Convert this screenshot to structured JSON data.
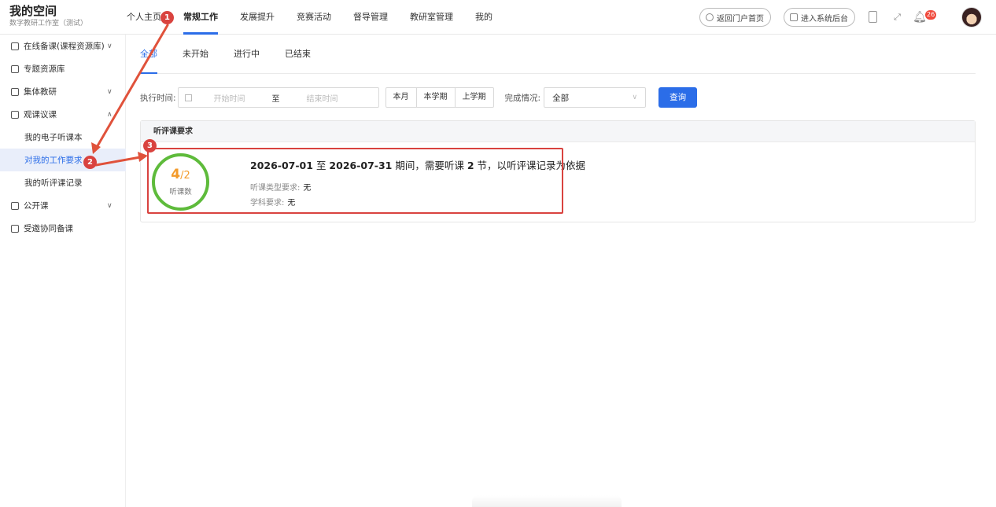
{
  "brand": {
    "title": "我的空间",
    "subtitle": "数字教研工作室（测试）"
  },
  "nav": {
    "items": [
      "个人主页",
      "常规工作",
      "发展提升",
      "竞赛活动",
      "督导管理",
      "教研室管理",
      "我的"
    ],
    "active": "常规工作"
  },
  "header_buttons": {
    "portal": "返回门户首页",
    "admin": "进入系统后台",
    "notifications": "26"
  },
  "sidebar": {
    "items": [
      {
        "label": "在线备课(课程资源库)",
        "chev": "∨"
      },
      {
        "label": "专题资源库"
      },
      {
        "label": "集体教研",
        "chev": "∨"
      },
      {
        "label": "观课议课",
        "chev": "∧"
      },
      {
        "label": "我的电子听课本"
      },
      {
        "label": "对我的工作要求"
      },
      {
        "label": "我的听评课记录"
      },
      {
        "label": "公开课",
        "chev": "∨"
      },
      {
        "label": "受邀协同备课"
      }
    ]
  },
  "tabs": [
    "全部",
    "未开始",
    "进行中",
    "已结束"
  ],
  "filter": {
    "label": "执行时间:",
    "start_placeholder": "开始时间",
    "separator": "至",
    "end_placeholder": "结束时间",
    "quick_ranges": [
      "本月",
      "本学期",
      "上学期"
    ],
    "status_label": "完成情况:",
    "status_value": "全部",
    "query_button": "查询"
  },
  "card": {
    "header": "听评课要求",
    "ring": {
      "done": "4",
      "target": "/2",
      "label": "听课数"
    },
    "title_parts": {
      "start": "2026-07-01",
      "to": " 至 ",
      "end": "2026-07-31",
      "mid": " 期间，需要听课 ",
      "count": "2",
      "tail": " 节，以听评课记录为依据"
    },
    "type_label": "听课类型要求:",
    "type_value": "无",
    "subject_label": "学科要求:",
    "subject_value": "无"
  },
  "markers": [
    "1",
    "2",
    "3"
  ],
  "colors": {
    "accent": "#2b6de8",
    "annotation": "#d9433f",
    "ring": "#5ebb3b",
    "count": "#f39b2b"
  }
}
